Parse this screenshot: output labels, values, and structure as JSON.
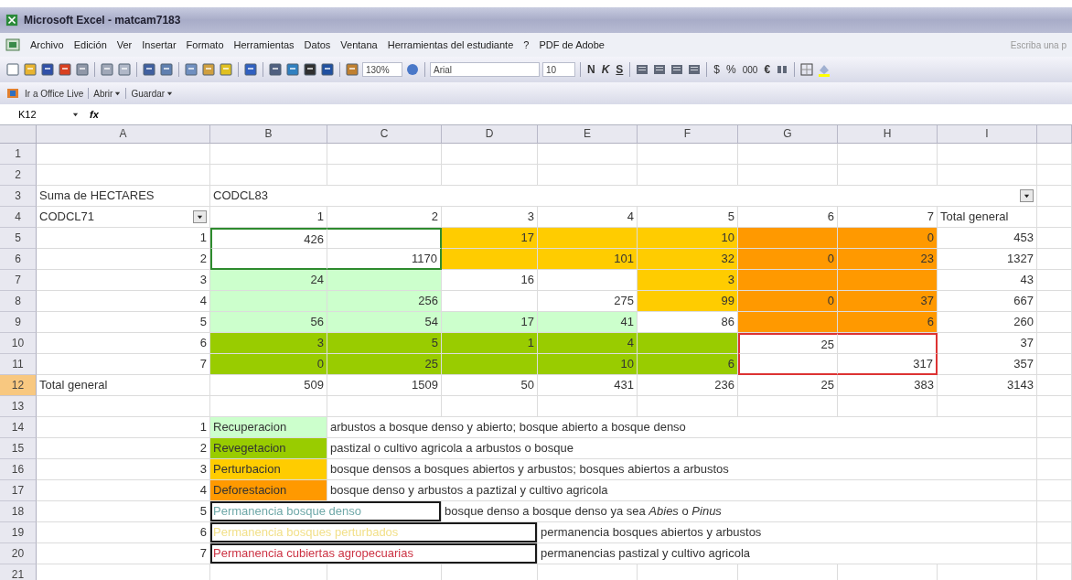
{
  "window": {
    "title": "Microsoft Excel - matcam7183"
  },
  "menu": {
    "items": [
      "Archivo",
      "Edición",
      "Ver",
      "Insertar",
      "Formato",
      "Herramientas",
      "Datos",
      "Ventana",
      "Herramientas del estudiante",
      "?",
      "PDF de Adobe"
    ],
    "help_box": "Escriba una p"
  },
  "toolbar": {
    "zoom": "130%",
    "font": "Arial",
    "size": "10",
    "bold": "N",
    "italic": "K",
    "underline": "S",
    "currency": "$",
    "percent": "%",
    "thousands": "000",
    "euro": "€"
  },
  "office_live_bar": {
    "items": [
      "Ir a Office Live",
      "Abrir",
      "Guardar"
    ]
  },
  "formula_bar": {
    "name_box": "K12",
    "function_label": "fx"
  },
  "sheet": {
    "columns": [
      "A",
      "B",
      "C",
      "D",
      "E",
      "F",
      "G",
      "H",
      "I"
    ],
    "rows": [
      {
        "number": "1",
        "selected": false,
        "cells": [
          {},
          {},
          {},
          {},
          {},
          {},
          {},
          {},
          {}
        ]
      },
      {
        "number": "2",
        "selected": false,
        "cells": [
          {},
          {},
          {},
          {},
          {},
          {},
          {},
          {},
          {}
        ]
      },
      {
        "number": "3",
        "selected": false,
        "cells": [
          {
            "text": "Suma de HECTARES",
            "kind": "text"
          },
          {
            "text": "CODCL83",
            "kind": "text",
            "dropdown": true
          },
          {},
          {},
          {},
          {},
          {},
          {},
          {}
        ]
      },
      {
        "number": "4",
        "selected": false,
        "cells": [
          {
            "text": "CODCL71",
            "kind": "text",
            "dropdown": true
          },
          {
            "text": "1",
            "kind": "number"
          },
          {
            "text": "2",
            "kind": "number"
          },
          {
            "text": "3",
            "kind": "number"
          },
          {
            "text": "4",
            "kind": "number"
          },
          {
            "text": "5",
            "kind": "number"
          },
          {
            "text": "6",
            "kind": "number"
          },
          {
            "text": "7",
            "kind": "number"
          },
          {
            "text": "Total general",
            "kind": "text"
          }
        ]
      },
      {
        "number": "5",
        "selected": false,
        "cells": [
          {
            "text": "1",
            "kind": "number"
          },
          {
            "text": "426",
            "kind": "number",
            "frame": {
              "color": "#2e8b2e"
            }
          },
          {
            "frame": {
              "color": "#2e8b2e"
            }
          },
          {
            "text": "17",
            "kind": "number",
            "color": "#ffcc00"
          },
          {
            "color": "#ffcc00"
          },
          {
            "text": "10",
            "kind": "number",
            "color": "#ffcc00"
          },
          {
            "color": "#ff9900"
          },
          {
            "text": "0",
            "kind": "number",
            "color": "#ff9900"
          },
          {
            "text": "453",
            "kind": "number"
          }
        ]
      },
      {
        "number": "6",
        "selected": false,
        "cells": [
          {
            "text": "2",
            "kind": "number"
          },
          {
            "frame": {
              "color": "#2e8b2e"
            }
          },
          {
            "text": "1170",
            "kind": "number",
            "frame": {
              "color": "#2e8b2e"
            }
          },
          {
            "color": "#ffcc00"
          },
          {
            "text": "101",
            "kind": "number",
            "color": "#ffcc00"
          },
          {
            "text": "32",
            "kind": "number",
            "color": "#ffcc00"
          },
          {
            "text": "0",
            "kind": "number",
            "color": "#ff9900"
          },
          {
            "text": "23",
            "kind": "number",
            "color": "#ff9900"
          },
          {
            "text": "1327",
            "kind": "number"
          }
        ]
      },
      {
        "number": "7",
        "selected": false,
        "cells": [
          {
            "text": "3",
            "kind": "number"
          },
          {
            "text": "24",
            "kind": "number",
            "color": "#ccffcc"
          },
          {
            "color": "#ccffcc"
          },
          {
            "text": "16",
            "kind": "number"
          },
          {},
          {
            "text": "3",
            "kind": "number",
            "color": "#ffcc00"
          },
          {
            "color": "#ff9900"
          },
          {
            "color": "#ff9900"
          },
          {
            "text": "43",
            "kind": "number"
          }
        ]
      },
      {
        "number": "8",
        "selected": false,
        "cells": [
          {
            "text": "4",
            "kind": "number"
          },
          {
            "color": "#ccffcc"
          },
          {
            "text": "256",
            "kind": "number",
            "color": "#ccffcc"
          },
          {},
          {
            "text": "275",
            "kind": "number"
          },
          {
            "text": "99",
            "kind": "number",
            "color": "#ffcc00"
          },
          {
            "text": "0",
            "kind": "number",
            "color": "#ff9900"
          },
          {
            "text": "37",
            "kind": "number",
            "color": "#ff9900"
          },
          {
            "text": "667",
            "kind": "number"
          }
        ]
      },
      {
        "number": "9",
        "selected": false,
        "cells": [
          {
            "text": "5",
            "kind": "number"
          },
          {
            "text": "56",
            "kind": "number",
            "color": "#ccffcc"
          },
          {
            "text": "54",
            "kind": "number",
            "color": "#ccffcc"
          },
          {
            "text": "17",
            "kind": "number",
            "color": "#ccffcc"
          },
          {
            "text": "41",
            "kind": "number",
            "color": "#ccffcc"
          },
          {
            "text": "86",
            "kind": "number"
          },
          {
            "color": "#ff9900"
          },
          {
            "text": "6",
            "kind": "number",
            "color": "#ff9900"
          },
          {
            "text": "260",
            "kind": "number"
          }
        ]
      },
      {
        "number": "10",
        "selected": false,
        "cells": [
          {
            "text": "6",
            "kind": "number"
          },
          {
            "text": "3",
            "kind": "number",
            "color": "#99cc00"
          },
          {
            "text": "5",
            "kind": "number",
            "color": "#99cc00"
          },
          {
            "text": "1",
            "kind": "number",
            "color": "#99cc00"
          },
          {
            "text": "4",
            "kind": "number",
            "color": "#99cc00"
          },
          {
            "color": "#99cc00"
          },
          {
            "text": "25",
            "kind": "number",
            "frame": {
              "color": "#dd3333"
            }
          },
          {
            "frame": {
              "color": "#dd3333"
            }
          },
          {
            "text": "37",
            "kind": "number"
          }
        ]
      },
      {
        "number": "11",
        "selected": false,
        "cells": [
          {
            "text": "7",
            "kind": "number"
          },
          {
            "text": "0",
            "kind": "number",
            "color": "#99cc00"
          },
          {
            "text": "25",
            "kind": "number",
            "color": "#99cc00"
          },
          {
            "color": "#99cc00"
          },
          {
            "text": "10",
            "kind": "number",
            "color": "#99cc00"
          },
          {
            "text": "6",
            "kind": "number",
            "color": "#99cc00"
          },
          {
            "frame": {
              "color": "#dd3333"
            }
          },
          {
            "text": "317",
            "kind": "number",
            "frame": {
              "color": "#dd3333"
            }
          },
          {
            "text": "357",
            "kind": "number"
          }
        ]
      },
      {
        "number": "12",
        "selected": true,
        "cells": [
          {
            "text": "Total general",
            "kind": "text"
          },
          {
            "text": "509",
            "kind": "number"
          },
          {
            "text": "1509",
            "kind": "number"
          },
          {
            "text": "50",
            "kind": "number"
          },
          {
            "text": "431",
            "kind": "number"
          },
          {
            "text": "236",
            "kind": "number"
          },
          {
            "text": "25",
            "kind": "number"
          },
          {
            "text": "383",
            "kind": "number"
          },
          {
            "text": "3143",
            "kind": "number"
          }
        ]
      },
      {
        "number": "13",
        "selected": false,
        "cells": [
          {},
          {},
          {},
          {},
          {},
          {},
          {},
          {},
          {}
        ]
      },
      {
        "number": "14",
        "selected": false,
        "cells": [
          {
            "text": "1",
            "kind": "number"
          },
          {
            "text": "Recuperacion",
            "kind": "text",
            "color": "#ccffcc"
          },
          {
            "text": "arbustos a bosque denso y abierto; bosque abierto a bosque denso",
            "kind": "text"
          },
          {},
          {},
          {},
          {},
          {},
          {}
        ]
      },
      {
        "number": "15",
        "selected": false,
        "cells": [
          {
            "text": "2",
            "kind": "number"
          },
          {
            "text": "Revegetacion",
            "kind": "text",
            "color": "#99cc00"
          },
          {
            "text": "pastizal o cultivo agricola a arbustos o bosque",
            "kind": "text"
          },
          {},
          {},
          {},
          {},
          {},
          {}
        ]
      },
      {
        "number": "16",
        "selected": false,
        "cells": [
          {
            "text": "3",
            "kind": "number"
          },
          {
            "text": "Perturbacion",
            "kind": "text",
            "color": "#ffcc00"
          },
          {
            "text": "bosque densos a bosques abiertos y arbustos; bosques abiertos a arbustos",
            "kind": "text"
          },
          {},
          {},
          {},
          {},
          {},
          {}
        ]
      },
      {
        "number": "17",
        "selected": false,
        "cells": [
          {
            "text": "4",
            "kind": "number"
          },
          {
            "text": "Deforestacion",
            "kind": "text",
            "color": "#ff9900"
          },
          {
            "text": "bosque denso y arbustos a paztizal y cultivo agricola",
            "kind": "text"
          },
          {},
          {},
          {},
          {},
          {},
          {}
        ]
      },
      {
        "number": "18",
        "selected": false,
        "cells": [
          {
            "text": "5",
            "kind": "number"
          },
          {
            "text": "Permanencia bosque denso",
            "kind": "text",
            "ink": {
              "color": "#6fa8a8"
            },
            "boxed": true
          },
          {},
          {
            "text": "bosque denso a bosque denso ya sea *Abies* o *Pinus*",
            "kind": "text"
          },
          {},
          {},
          {},
          {},
          {}
        ]
      },
      {
        "number": "19",
        "selected": false,
        "cells": [
          {
            "text": "6",
            "kind": "number"
          },
          {
            "text": "Permanencia bosques perturbados",
            "kind": "text",
            "ink": {
              "color": "#f2e08a"
            },
            "boxed": true
          },
          {},
          {},
          {
            "text": "permanencia bosques abiertos y arbustos",
            "kind": "text"
          },
          {},
          {},
          {},
          {}
        ]
      },
      {
        "number": "20",
        "selected": false,
        "cells": [
          {
            "text": "7",
            "kind": "number"
          },
          {
            "text": "Permanencia cubiertas agropecuarias",
            "kind": "text",
            "ink": {
              "color": "#cc3344"
            },
            "boxed": true
          },
          {},
          {},
          {
            "text": "permanencias pastizal y cultivo agricola",
            "kind": "text"
          },
          {},
          {},
          {},
          {}
        ]
      },
      {
        "number": "21",
        "selected": false,
        "cells": [
          {},
          {},
          {},
          {},
          {},
          {},
          {},
          {},
          {}
        ]
      }
    ]
  }
}
